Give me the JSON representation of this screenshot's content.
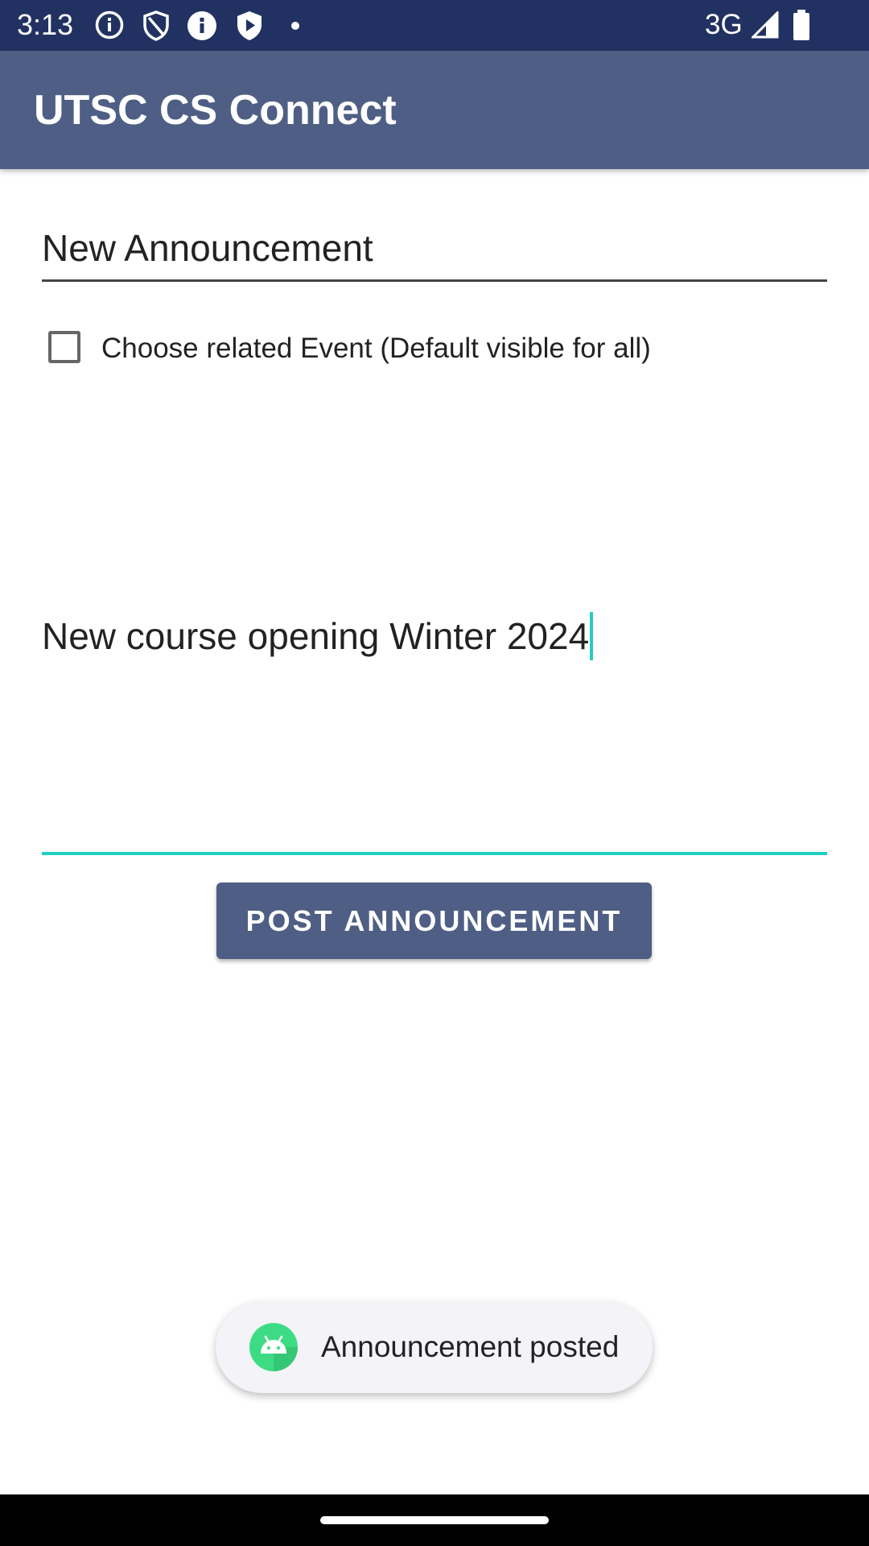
{
  "status_bar": {
    "time": "3:13",
    "network": "3G",
    "icons": [
      "info-circle-icon",
      "shield-icon",
      "info-filled-icon",
      "play-shield-icon",
      "dot-icon",
      "signal-icon",
      "battery-icon"
    ]
  },
  "app_bar": {
    "title": "UTSC CS Connect"
  },
  "form": {
    "title_value": "New Announcement",
    "checkbox_label": "Choose related Event (Default visible for all)",
    "checkbox_checked": false,
    "body_value": "New course opening Winter 2024",
    "post_button_label": "POST ANNOUNCEMENT"
  },
  "toast": {
    "message": "Announcement posted",
    "icon": "android-icon"
  },
  "colors": {
    "status_bar": "#213262",
    "app_bar": "#4f5e84",
    "accent": "#1fcfc1",
    "button": "#4f5e84",
    "toast_bg": "#f4f3f8"
  }
}
